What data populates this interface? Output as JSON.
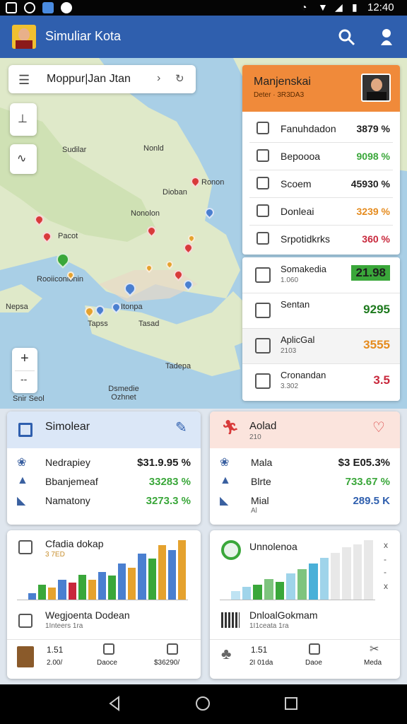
{
  "status_bar": {
    "time": "12:40"
  },
  "app_bar": {
    "title": "Simuliar Kota",
    "icons": [
      "search-icon",
      "person-icon"
    ]
  },
  "map": {
    "search": {
      "text": "Moppur|Jan Jtan"
    },
    "labels": [
      "Sudilar",
      "Nonld",
      "Dioban",
      "Ronon",
      "Nonolon",
      "Pacot",
      "Rooiiconionin",
      "Nepsa",
      "Itonpa",
      "Tapss",
      "Tasad",
      "Tadepa",
      "Dsmedie Ozhnet",
      "Snir Seol"
    ],
    "zoom_in": "+",
    "zoom_out": "--"
  },
  "panel": {
    "title": "Manjenskai",
    "subtitle": "Deter · 3R3DA3",
    "rows": [
      {
        "label": "Fanuhdadon",
        "value": "3879 %",
        "color": "#1e1e1e",
        "icon": "document-icon"
      },
      {
        "label": "Bepoooa",
        "value": "9098 %",
        "color": "#3aa73a",
        "icon": "people-icon"
      },
      {
        "label": "Scoem",
        "value": "45930 %",
        "color": "#1e1e1e",
        "icon": "location-icon"
      },
      {
        "label": "Donleai",
        "value": "3239 %",
        "color": "#e58b1e",
        "icon": "folder-icon"
      },
      {
        "label": "Srpotidkrks",
        "value": "360 %",
        "color": "#c8283c",
        "icon": "box-icon"
      }
    ],
    "rows2": [
      {
        "label": "Somakedia",
        "sub": "1.060",
        "value": "21.98",
        "badge": true,
        "icon": "cube-icon"
      },
      {
        "label": "Sentan",
        "sub": "",
        "value": "9295",
        "color": "#1e7a1e",
        "icon": "star-icon"
      },
      {
        "label": "AplicGal",
        "sub": "2103",
        "value": "3555",
        "color": "#e58b1e",
        "icon": "chart-icon"
      },
      {
        "label": "Cronandan",
        "sub": "3.302",
        "value": "3.5",
        "color": "#c8283c",
        "icon": "books-icon"
      }
    ]
  },
  "card_simulasi": {
    "title": "Simolear",
    "rows": [
      {
        "label": "Nedrapiey",
        "value": "$31.9.95 %",
        "color": "#1e1e1e"
      },
      {
        "label": "Bbanjemeaf",
        "value": "33283 %",
        "color": "#3aa73a"
      },
      {
        "label": "Namatony",
        "value": "3273.3 %",
        "color": "#3aa73a"
      }
    ]
  },
  "card_alert": {
    "title": "Aolad",
    "sub": "210",
    "rows": [
      {
        "label": "Mala",
        "value": "$3 E05.3%",
        "color": "#1e1e1e"
      },
      {
        "label": "Blrte",
        "value": "733.67 %",
        "color": "#3aa73a"
      },
      {
        "label": "Mial",
        "sub": "Al",
        "value": "289.5 K",
        "color": "#2f5fae"
      }
    ]
  },
  "card_chart1": {
    "title": "Cfadia dokap",
    "sub": "3 7ED",
    "footer_title": "Wegjoenta Dodean",
    "footer_sub": "1Inteers 1ra",
    "stats": [
      {
        "value": "1.51",
        "label": "2.00/"
      },
      {
        "value": "",
        "label": "Daoce"
      },
      {
        "value": "",
        "label": "$36290/"
      }
    ]
  },
  "card_chart2": {
    "title": "Unnolenoa",
    "footer_title": "DnloalGokmam",
    "footer_sub": "1I1ceata 1ra",
    "stats": [
      {
        "value": "1.51",
        "label": "2I 01da"
      },
      {
        "value": "",
        "label": "Daoe"
      },
      {
        "value": "",
        "label": "Meda"
      }
    ],
    "side_marks": [
      "x",
      "-",
      "-",
      "x"
    ]
  },
  "chart_data": [
    {
      "type": "bar",
      "values": [
        10,
        22,
        18,
        30,
        26,
        38,
        30,
        42,
        36,
        55,
        48,
        70,
        62,
        82,
        75,
        90
      ],
      "colors": [
        "#4a7fd0",
        "#3aa73a",
        "#e5a22e",
        "#4a7fd0",
        "#c8283c",
        "#3aa73a",
        "#e5a22e",
        "#4a7fd0",
        "#3aa73a",
        "#4a7fd0",
        "#e5a22e",
        "#4a7fd0",
        "#3aa73a",
        "#e5a22e",
        "#4a7fd0",
        "#e5a22e"
      ]
    },
    {
      "type": "bar",
      "values": [
        12,
        18,
        22,
        30,
        26,
        38,
        44,
        52,
        60,
        68,
        76,
        80,
        86
      ],
      "colors": [
        "#bfe3f3",
        "#9fd4ea",
        "#3aa73a",
        "#7ec47e",
        "#3aa73a",
        "#9fd4ea",
        "#7ec47e",
        "#4ab0d8",
        "#9fd4ea",
        "#e8e8e8",
        "#e8e8e8",
        "#e8e8e8",
        "#e8e8e8"
      ]
    }
  ]
}
